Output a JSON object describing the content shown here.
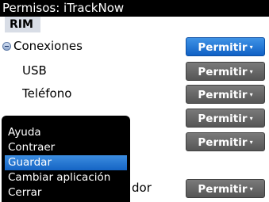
{
  "title": "Permisos: iTrackNow",
  "vendor_tab": "RIM",
  "rows": [
    {
      "label": "Conexiones",
      "button": "Permitir",
      "arrow": "▾"
    },
    {
      "label": "USB",
      "button": "Permitir",
      "arrow": "▾"
    },
    {
      "label": "Teléfono",
      "button": "Permitir",
      "arrow": "▾"
    },
    {
      "label": "",
      "button": "Permitir",
      "arrow": "▾"
    },
    {
      "label": "",
      "button": "Permitir",
      "arrow": "▾"
    },
    {
      "label": "dor",
      "button": "Permitir",
      "arrow": "▾"
    }
  ],
  "menu": {
    "items": [
      "Ayuda",
      "Contraer",
      "Guardar",
      "Cambiar aplicación",
      "Cerrar"
    ],
    "selected_item": "Guardar"
  },
  "colors": {
    "active_button": "#1a6fd1",
    "button": "#626262",
    "menu_selected": "#2a7be0",
    "title_bar": "#000000"
  },
  "icons": {
    "collapse": "collapse-circle-icon",
    "dropdown": "dropdown-arrow-icon"
  }
}
